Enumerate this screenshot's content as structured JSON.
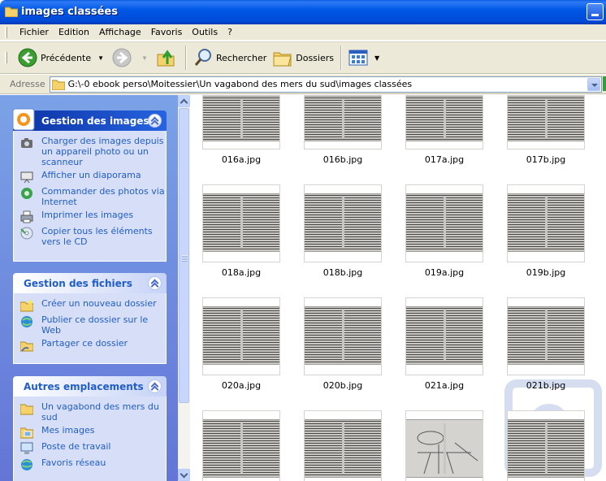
{
  "window": {
    "title": "images classées"
  },
  "menu": [
    "Fichier",
    "Edition",
    "Affichage",
    "Favoris",
    "Outils",
    "?"
  ],
  "toolbar": {
    "back_label": "Précédente",
    "search_label": "Rechercher",
    "folders_label": "Dossiers"
  },
  "address": {
    "label": "Adresse",
    "path": "G:\\-0 ebook perso\\Moitessier\\Un vagabond des mers du sud\\images classées"
  },
  "panels": {
    "images": {
      "title": "Gestion des images",
      "tasks": [
        {
          "label": "Charger des images depuis un appareil photo ou un scanneur",
          "icon": "camera-icon"
        },
        {
          "label": "Afficher un diaporama",
          "icon": "slideshow-icon"
        },
        {
          "label": "Commander des photos via Internet",
          "icon": "order-photos-icon"
        },
        {
          "label": "Imprimer les images",
          "icon": "printer-icon"
        },
        {
          "label": "Copier tous les éléments vers le CD",
          "icon": "cd-copy-icon"
        }
      ]
    },
    "files": {
      "title": "Gestion des fichiers",
      "tasks": [
        {
          "label": "Créer un nouveau dossier",
          "icon": "new-folder-icon"
        },
        {
          "label": "Publier ce dossier sur le Web",
          "icon": "web-publish-icon"
        },
        {
          "label": "Partager ce dossier",
          "icon": "share-folder-icon"
        }
      ]
    },
    "places": {
      "title": "Autres emplacements",
      "tasks": [
        {
          "label": "Un vagabond des mers du sud",
          "icon": "folder-icon"
        },
        {
          "label": "Mes images",
          "icon": "my-pictures-icon"
        },
        {
          "label": "Poste de travail",
          "icon": "my-computer-icon"
        },
        {
          "label": "Favoris réseau",
          "icon": "network-icon"
        }
      ]
    }
  },
  "files": [
    {
      "name": "016a.jpg"
    },
    {
      "name": "016b.jpg"
    },
    {
      "name": "017a.jpg"
    },
    {
      "name": "017b.jpg"
    },
    {
      "name": "018a.jpg"
    },
    {
      "name": "018b.jpg"
    },
    {
      "name": "019a.jpg"
    },
    {
      "name": "019b.jpg"
    },
    {
      "name": "020a.jpg"
    },
    {
      "name": "020b.jpg"
    },
    {
      "name": "021a.jpg"
    },
    {
      "name": "021b.jpg"
    },
    {
      "name": ""
    },
    {
      "name": ""
    },
    {
      "name": ""
    },
    {
      "name": ""
    }
  ],
  "colors": {
    "titlebar": "#0058e6",
    "task_link": "#215dc6",
    "panel_bg": "#d6dff7"
  }
}
